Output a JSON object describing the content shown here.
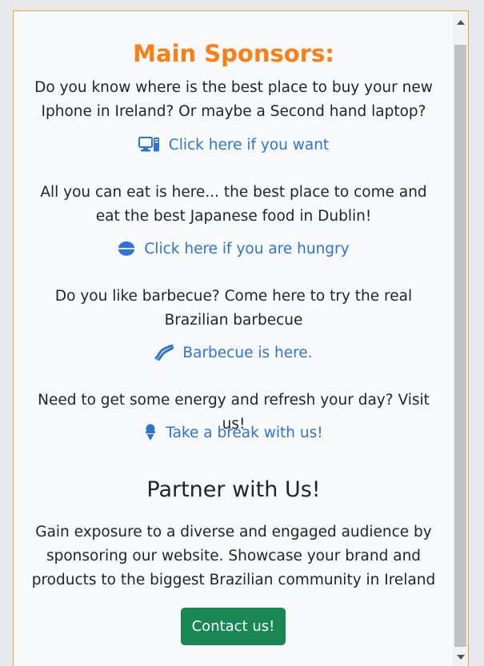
{
  "sponsors": {
    "title": "Main Sponsors:",
    "items": [
      {
        "text": "Do you know where is the best place to buy your new Iphone in Ireland? Or maybe a Second hand laptop?",
        "link": "Click here if you want",
        "icon": "computer-icon"
      },
      {
        "text": "All you can eat is here... the best place to come and eat the best Japanese food in Dublin!",
        "link": "Click here if you are hungry",
        "icon": "bowl-food-icon"
      },
      {
        "text": "Do you like barbecue? Come here to try the real Brazilian barbecue",
        "link": "Barbecue is here.",
        "icon": "bacon-icon"
      },
      {
        "text": "Need to get some energy and refresh your day? Visit us!",
        "link": "Take a break with us!",
        "icon": "ice-cream-icon"
      }
    ]
  },
  "partner": {
    "title": "Partner with Us!",
    "text": "Gain exposure to a diverse and engaged audience by sponsoring our website. Showcase your brand and products to the biggest Brazilian community in Ireland",
    "button_label": "Contact us!"
  },
  "colors": {
    "accent": "#fd7e14",
    "link": "#2d74d6",
    "button": "#198754"
  }
}
